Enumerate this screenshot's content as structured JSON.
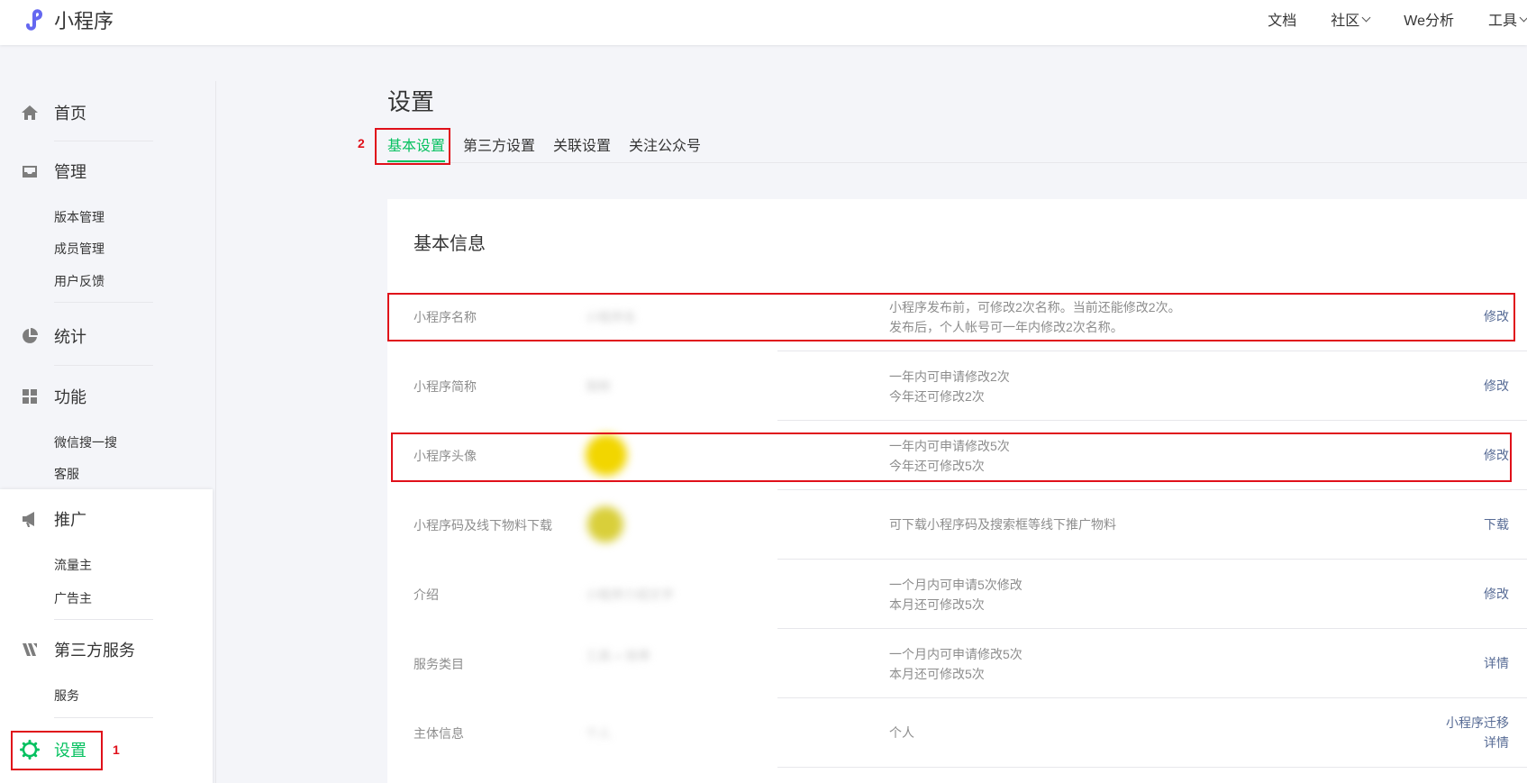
{
  "app": {
    "logo_text": "小程序"
  },
  "topnav": {
    "items": [
      "文档",
      "社区",
      "We分析",
      "工具"
    ]
  },
  "sidebar": {
    "groups": [
      {
        "label": "首页",
        "icon": "home-icon"
      },
      {
        "label": "管理",
        "icon": "inbox-icon",
        "items": [
          "版本管理",
          "成员管理",
          "用户反馈"
        ]
      },
      {
        "label": "统计",
        "icon": "pie-chart-icon"
      },
      {
        "label": "功能",
        "icon": "grid-icon",
        "items": [
          "微信搜一搜",
          "客服"
        ]
      },
      {
        "label": "推广",
        "icon": "megaphone-icon",
        "items": [
          "流量主",
          "广告主"
        ]
      },
      {
        "label": "第三方服务",
        "icon": "third-party-icon",
        "items": [
          "服务"
        ]
      },
      {
        "label": "设置",
        "icon": "gear-icon",
        "active": true
      }
    ]
  },
  "page": {
    "title": "设置"
  },
  "tabs": [
    "基本设置",
    "第三方设置",
    "关联设置",
    "关注公众号"
  ],
  "card": {
    "title": "基本信息",
    "rows": [
      {
        "label": "小程序名称",
        "value": "小程序名",
        "desc": [
          "小程序发布前，可修改2次名称。当前还能修改2次。",
          "发布后，个人帐号可一年内修改2次名称。"
        ],
        "action": [
          "修改"
        ]
      },
      {
        "label": "小程序简称",
        "value": "简称",
        "desc": [
          "一年内可申请修改2次",
          "今年还可修改2次"
        ],
        "action": [
          "修改"
        ]
      },
      {
        "label": "小程序头像",
        "value": "",
        "desc": [
          "一年内可申请修改5次",
          "今年还可修改5次"
        ],
        "action": [
          "修改"
        ]
      },
      {
        "label": "小程序码及线下物料下载",
        "value": "",
        "desc": [
          "可下载小程序码及搜索框等线下推广物料"
        ],
        "action": [
          "下载"
        ]
      },
      {
        "label": "介绍",
        "value": "小程序介绍文字",
        "desc": [
          "一个月内可申请5次修改",
          "本月还可修改5次"
        ],
        "action": [
          "修改"
        ]
      },
      {
        "label": "服务类目",
        "value": "工具 > 效率",
        "desc": [
          "一个月内可申请修改5次",
          "本月还可修改5次"
        ],
        "action": [
          "详情"
        ]
      },
      {
        "label": "主体信息",
        "value": "个人",
        "desc": [
          "个人"
        ],
        "action": [
          "小程序迁移",
          "详情"
        ]
      }
    ]
  },
  "annotations": {
    "step1": "1",
    "step2": "2"
  },
  "colors": {
    "accent": "#07c160",
    "link": "#576b95",
    "highlight": "#e0101a"
  }
}
